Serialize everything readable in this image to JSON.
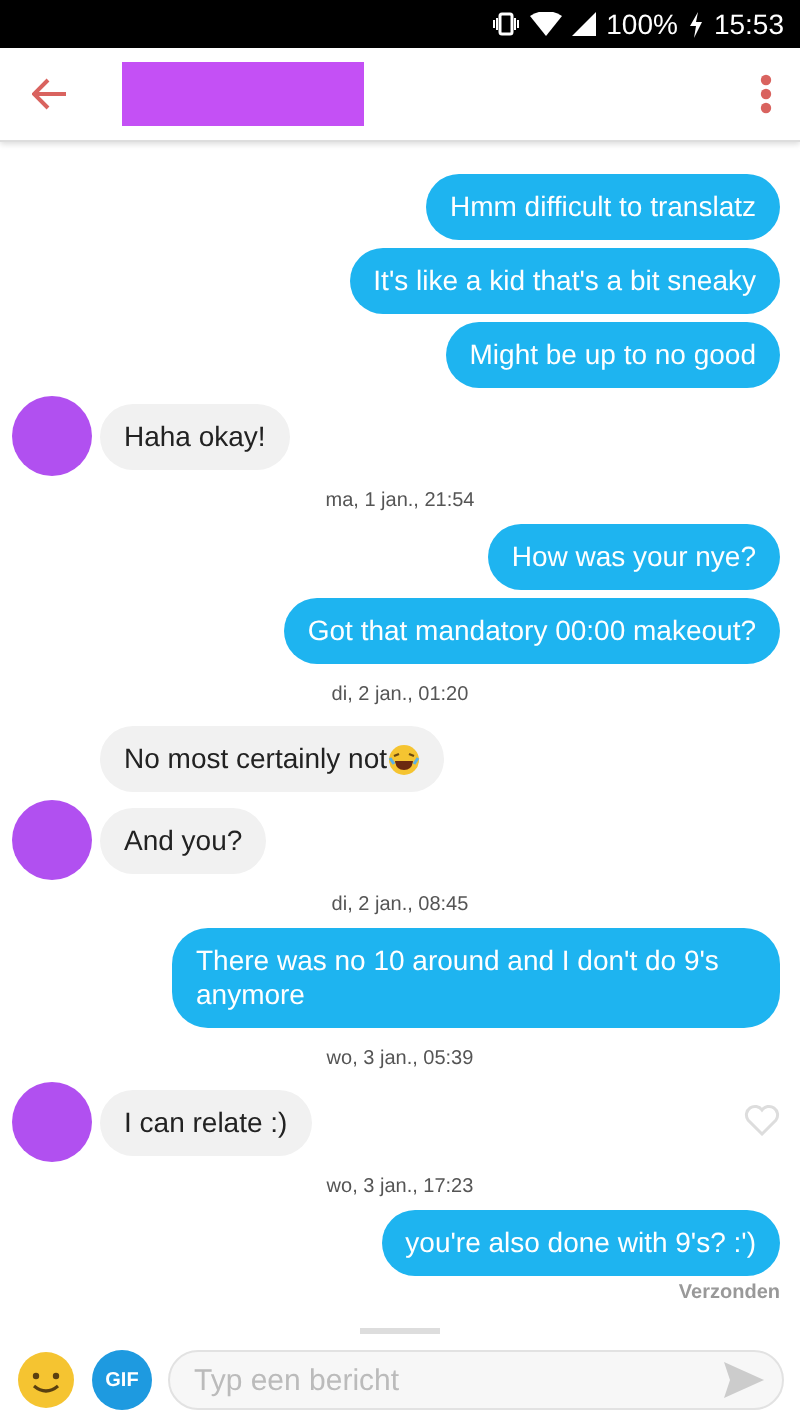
{
  "status_bar": {
    "battery": "100%",
    "time": "15:53"
  },
  "messages": [
    {
      "kind": "sent",
      "text": "Hmm difficult to translatz"
    },
    {
      "kind": "sent",
      "text": "It's like a kid that's a bit sneaky"
    },
    {
      "kind": "sent",
      "text": "Might be up to no good"
    },
    {
      "kind": "received",
      "text": "Haha okay!",
      "avatar": true
    },
    {
      "kind": "timestamp",
      "text": "ma, 1 jan., 21:54"
    },
    {
      "kind": "sent",
      "text": "How was your nye?"
    },
    {
      "kind": "sent",
      "text": "Got that mandatory 00:00 makeout?"
    },
    {
      "kind": "timestamp",
      "text": "di, 2 jan., 01:20"
    },
    {
      "kind": "received",
      "text": "No most certainly not",
      "emoji": true,
      "avatar": false
    },
    {
      "kind": "received",
      "text": "And you?",
      "avatar": true
    },
    {
      "kind": "timestamp",
      "text": "di, 2 jan., 08:45"
    },
    {
      "kind": "sent",
      "text": "There was no 10 around and I don't do 9's anymore"
    },
    {
      "kind": "timestamp",
      "text": "wo, 3 jan., 05:39"
    },
    {
      "kind": "received",
      "text": "I can relate :)",
      "avatar": true,
      "liked": false
    },
    {
      "kind": "timestamp",
      "text": "wo, 3 jan., 17:23"
    },
    {
      "kind": "sent",
      "text": "you're also done with 9's? :')",
      "status": "Verzonden"
    }
  ],
  "composer": {
    "gif_label": "GIF",
    "placeholder": "Typ een bericht"
  }
}
